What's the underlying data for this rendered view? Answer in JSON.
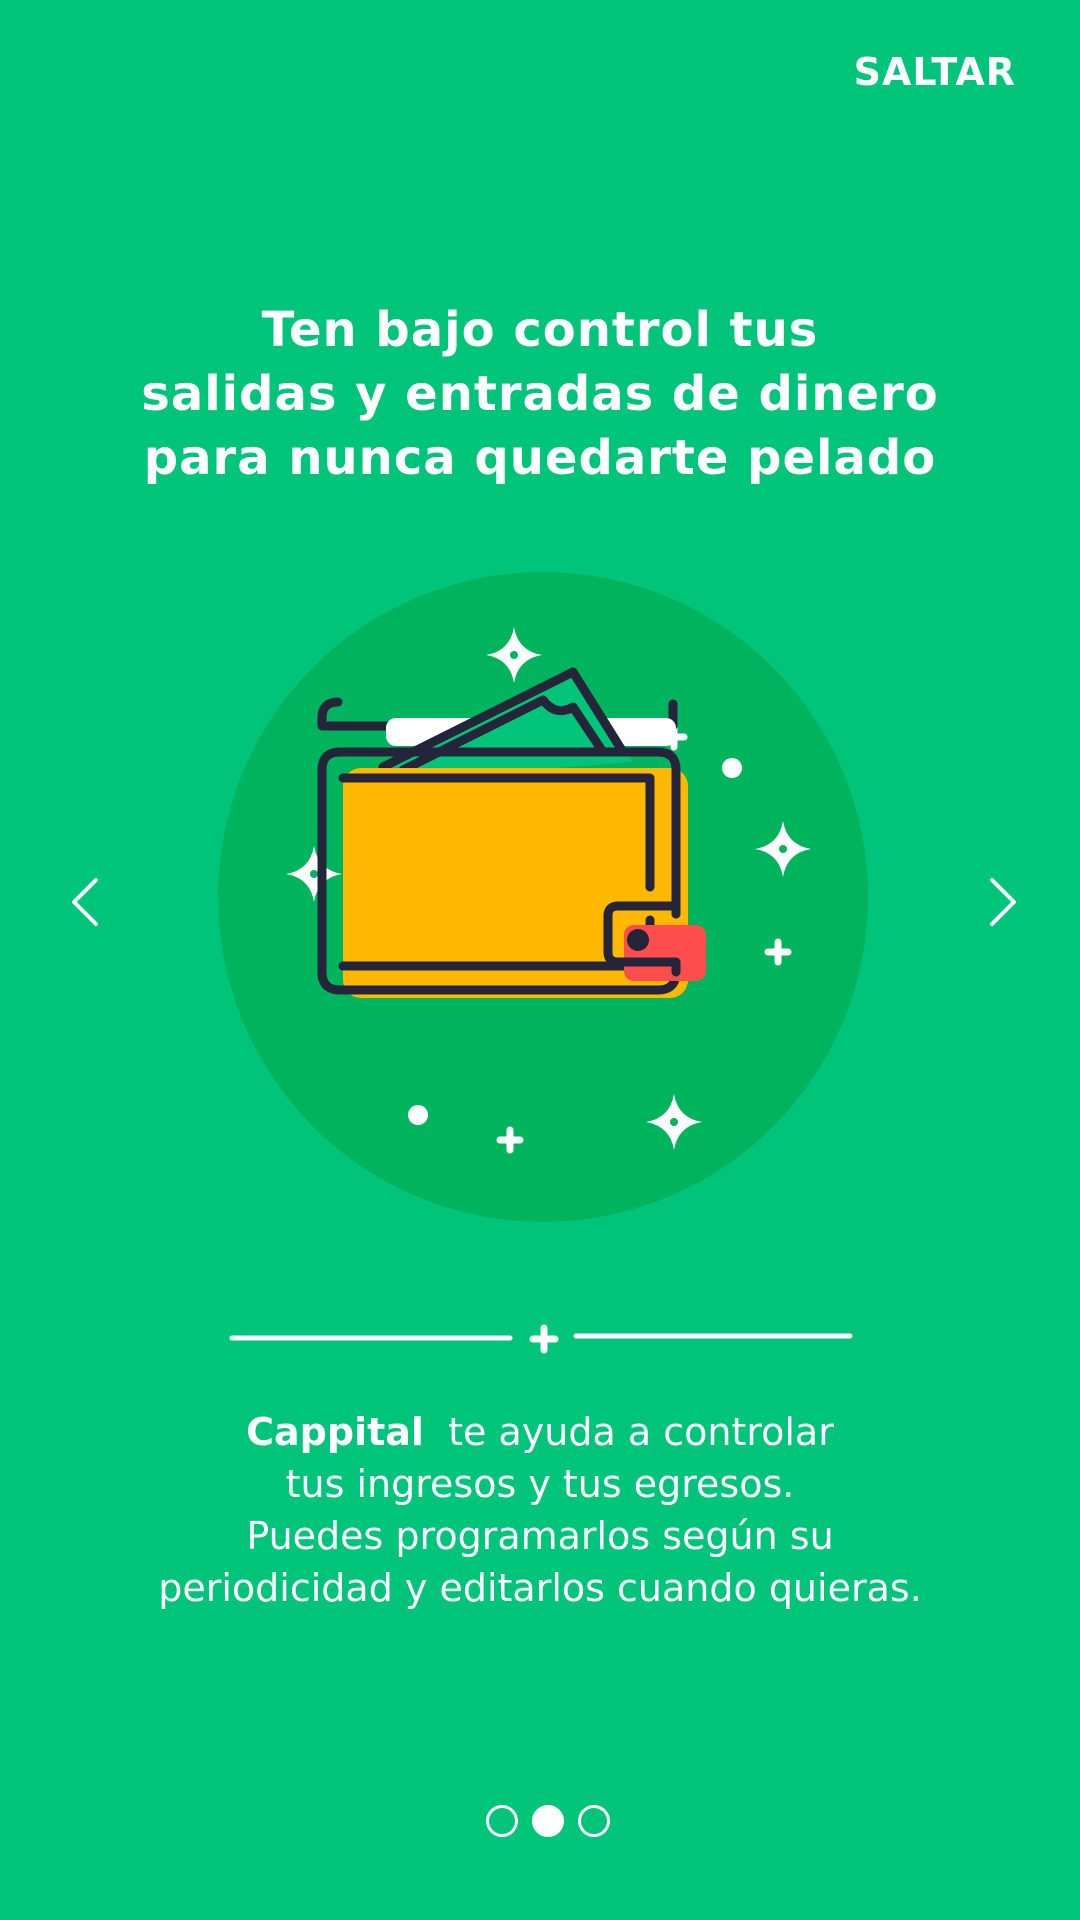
{
  "header": {
    "skip_label": "SALTAR"
  },
  "slide": {
    "title_lines": [
      "Ten bajo control tus",
      "salidas y entradas de dinero",
      "para nunca quedarte pelado"
    ],
    "illustration_icon": "wallet-icon",
    "description": {
      "brand": "Cappital",
      "line1_rest": "te ayuda a controlar",
      "line2": "tus ingresos y tus egresos.",
      "line3": "Puedes programarlos según su",
      "line4": "periodicidad y editarlos cuando quieras."
    }
  },
  "navigation": {
    "prev_icon": "chevron-left-icon",
    "next_icon": "chevron-right-icon"
  },
  "pagination": {
    "total": 3,
    "active_index": 1
  },
  "colors": {
    "background": "#00C47A",
    "circle": "#00B45E",
    "wallet": "#FFB800",
    "clasp": "#FF4D4D",
    "outline": "#24243A",
    "white": "#FFFFFF"
  }
}
